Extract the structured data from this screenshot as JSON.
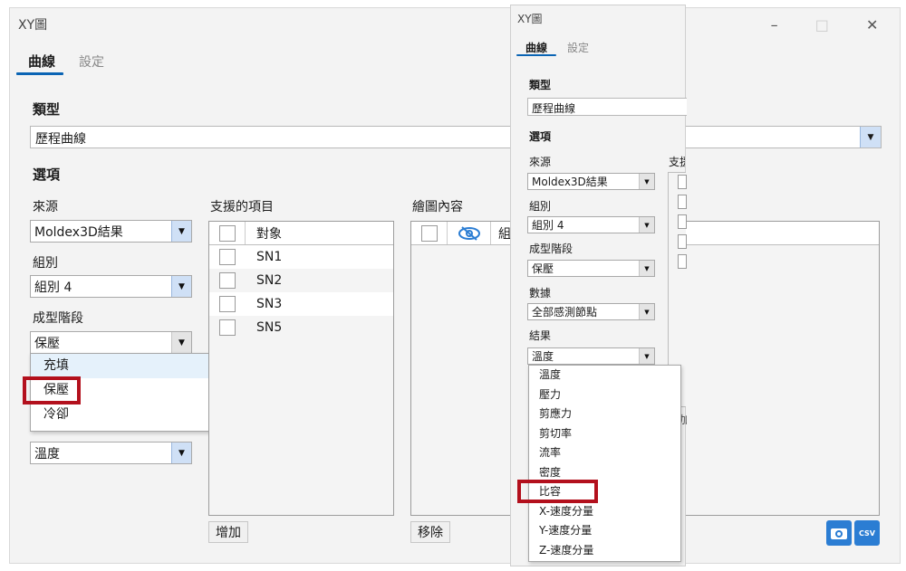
{
  "back": {
    "title": "XY圖",
    "tabs": [
      "曲線",
      "設定"
    ],
    "type_label": "類型",
    "type_value": "歷程曲線",
    "options_label": "選項",
    "source_label": "來源",
    "source_value": "Moldex3D結果",
    "group_label": "組別",
    "group_value": "組別 4",
    "stage_label": "成型階段",
    "stage_value": "保壓",
    "stage_options": [
      "充填",
      "保壓",
      "冷卻"
    ],
    "result_value": "溫度",
    "supported_label": "支援的項目",
    "supported_header": "對象",
    "supported_items": [
      "SN1",
      "SN2",
      "SN3",
      "SN5"
    ],
    "plot_label": "繪圖內容",
    "plot_header_partial": "組",
    "add_button": "增加",
    "remove_button": "移除"
  },
  "front": {
    "title": "XY圖",
    "tabs": [
      "曲線",
      "設定"
    ],
    "type_label": "類型",
    "type_value": "歷程曲線",
    "options_label": "選項",
    "source_label": "來源",
    "source_value": "Moldex3D結果",
    "group_label": "組別",
    "group_value": "組別 4",
    "stage_label": "成型階段",
    "stage_value": "保壓",
    "data_label": "數據",
    "data_value": "全部感測節點",
    "result_label": "結果",
    "result_value": "溫度",
    "result_options": [
      "溫度",
      "壓力",
      "剪應力",
      "剪切率",
      "流率",
      "密度",
      "比容",
      "X-速度分量",
      "Y-速度分量",
      "Z-速度分量"
    ],
    "partial_support_label": "支援",
    "partial_button_glyph": "加"
  },
  "window_controls": {
    "minimize": "–",
    "maximize": "□",
    "close": "✕"
  },
  "icons": {
    "camera": "camera-icon",
    "csv": "CSV"
  },
  "colors": {
    "accent": "#0a64b4",
    "highlight": "#b3101d",
    "hover": "#e5f1fb",
    "icon_blue": "#2b7dd3"
  }
}
